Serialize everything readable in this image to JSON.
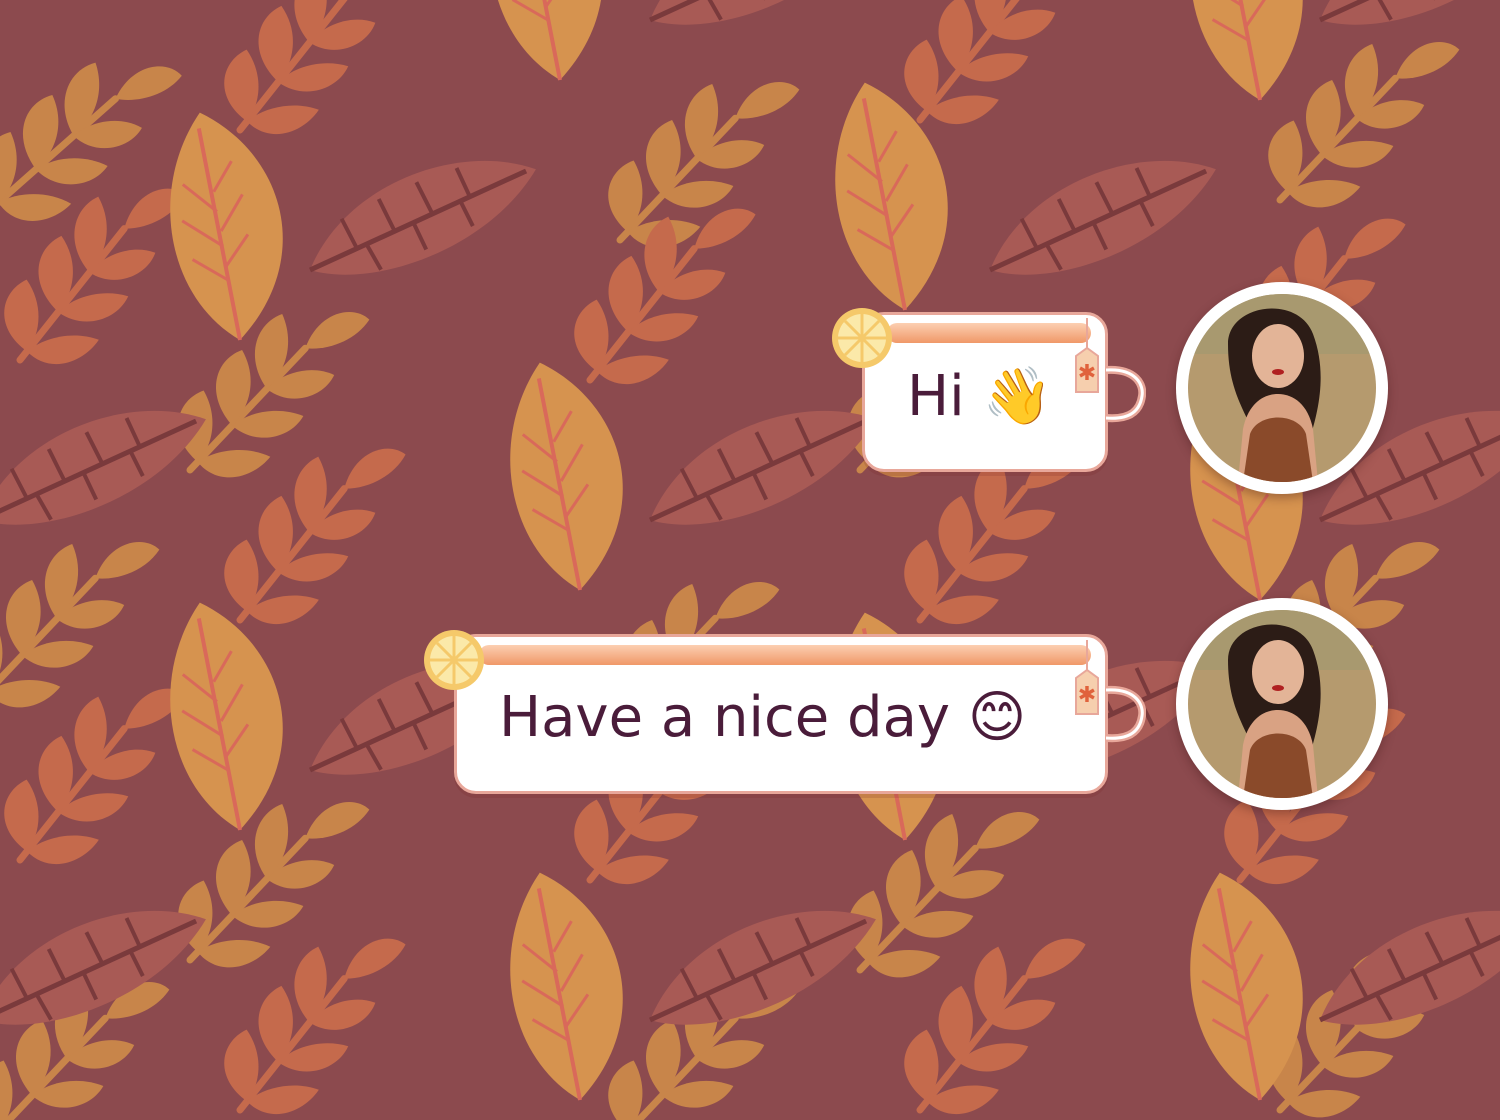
{
  "chat": {
    "messages": [
      {
        "text": "Hi 👋",
        "sender": "me"
      },
      {
        "text": "Have a nice day 😊",
        "sender": "me"
      }
    ]
  },
  "theme": {
    "background": "#8c4a4e",
    "leaf_colors": [
      "#c8854a",
      "#c56a4c",
      "#a85a55"
    ],
    "bubble_border": "#e8a79a",
    "bubble_band": "#f09868",
    "text_color": "#4a1c3a"
  },
  "icons": {
    "bubble_decorations": [
      "lemon-slice-icon",
      "cup-handle-icon",
      "tea-tag-icon"
    ],
    "avatar": "user-avatar-photo"
  }
}
